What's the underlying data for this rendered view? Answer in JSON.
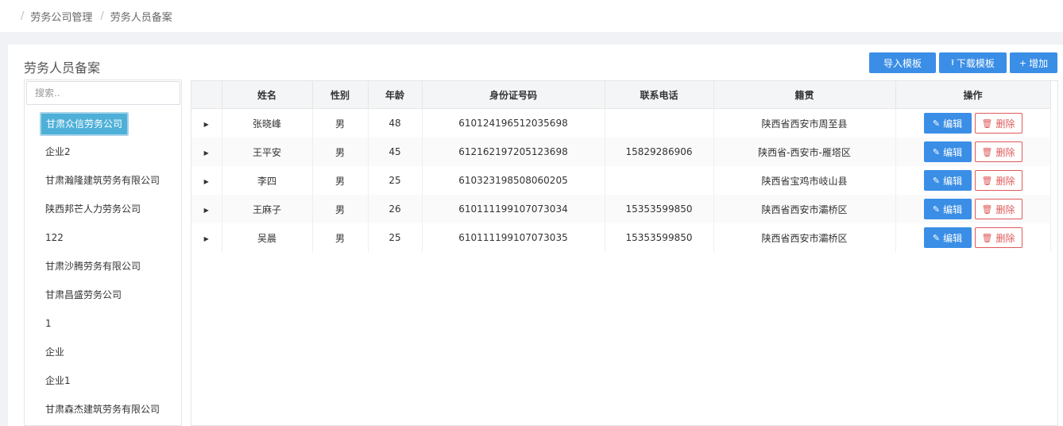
{
  "breadcrumb": {
    "items": [
      "劳务公司管理",
      "劳务人员备案"
    ]
  },
  "page_title": "劳务人员备案",
  "toolbar": {
    "import_label": "导入模板",
    "download_label": "下载模板",
    "add_label": "增加",
    "upload_icon": "upload-icon",
    "plus_icon": "plus-icon"
  },
  "search": {
    "placeholder": "搜索..",
    "value": ""
  },
  "companies": {
    "selected": "甘肃众信劳务公司",
    "items": [
      "企业2",
      "甘肃瀚隆建筑劳务有限公司",
      "陕西邦芒人力劳务公司",
      "122",
      "甘肃沙腾劳务有限公司",
      "甘肃昌盛劳务公司",
      "1",
      "企业",
      "企业1",
      "甘肃森杰建筑劳务有限公司"
    ]
  },
  "table": {
    "columns": [
      "姓名",
      "性别",
      "年龄",
      "身份证号码",
      "联系电话",
      "籍贯",
      "操作"
    ],
    "rows": [
      {
        "name": "张晓峰",
        "gender": "男",
        "age": "48",
        "id": "610124196512035698",
        "phone": "",
        "native": "陕西省西安市周至县"
      },
      {
        "name": "王平安",
        "gender": "男",
        "age": "45",
        "id": "612162197205123698",
        "phone": "15829286906",
        "native": "陕西省-西安市-雁塔区"
      },
      {
        "name": "李四",
        "gender": "男",
        "age": "25",
        "id": "610323198508060205",
        "phone": "",
        "native": "陕西省宝鸡市岐山县"
      },
      {
        "name": "王麻子",
        "gender": "男",
        "age": "26",
        "id": "610111199107073034",
        "phone": "15353599850",
        "native": "陕西省西安市灞桥区"
      },
      {
        "name": "吴晨",
        "gender": "男",
        "age": "25",
        "id": "610111199107073035",
        "phone": "15353599850",
        "native": "陕西省西安市灞桥区"
      }
    ],
    "edit_label": "编辑",
    "delete_label": "删除"
  },
  "colors": {
    "primary": "#3a8ee6",
    "danger": "#e05a5a",
    "selected": "#4eb0d8"
  }
}
